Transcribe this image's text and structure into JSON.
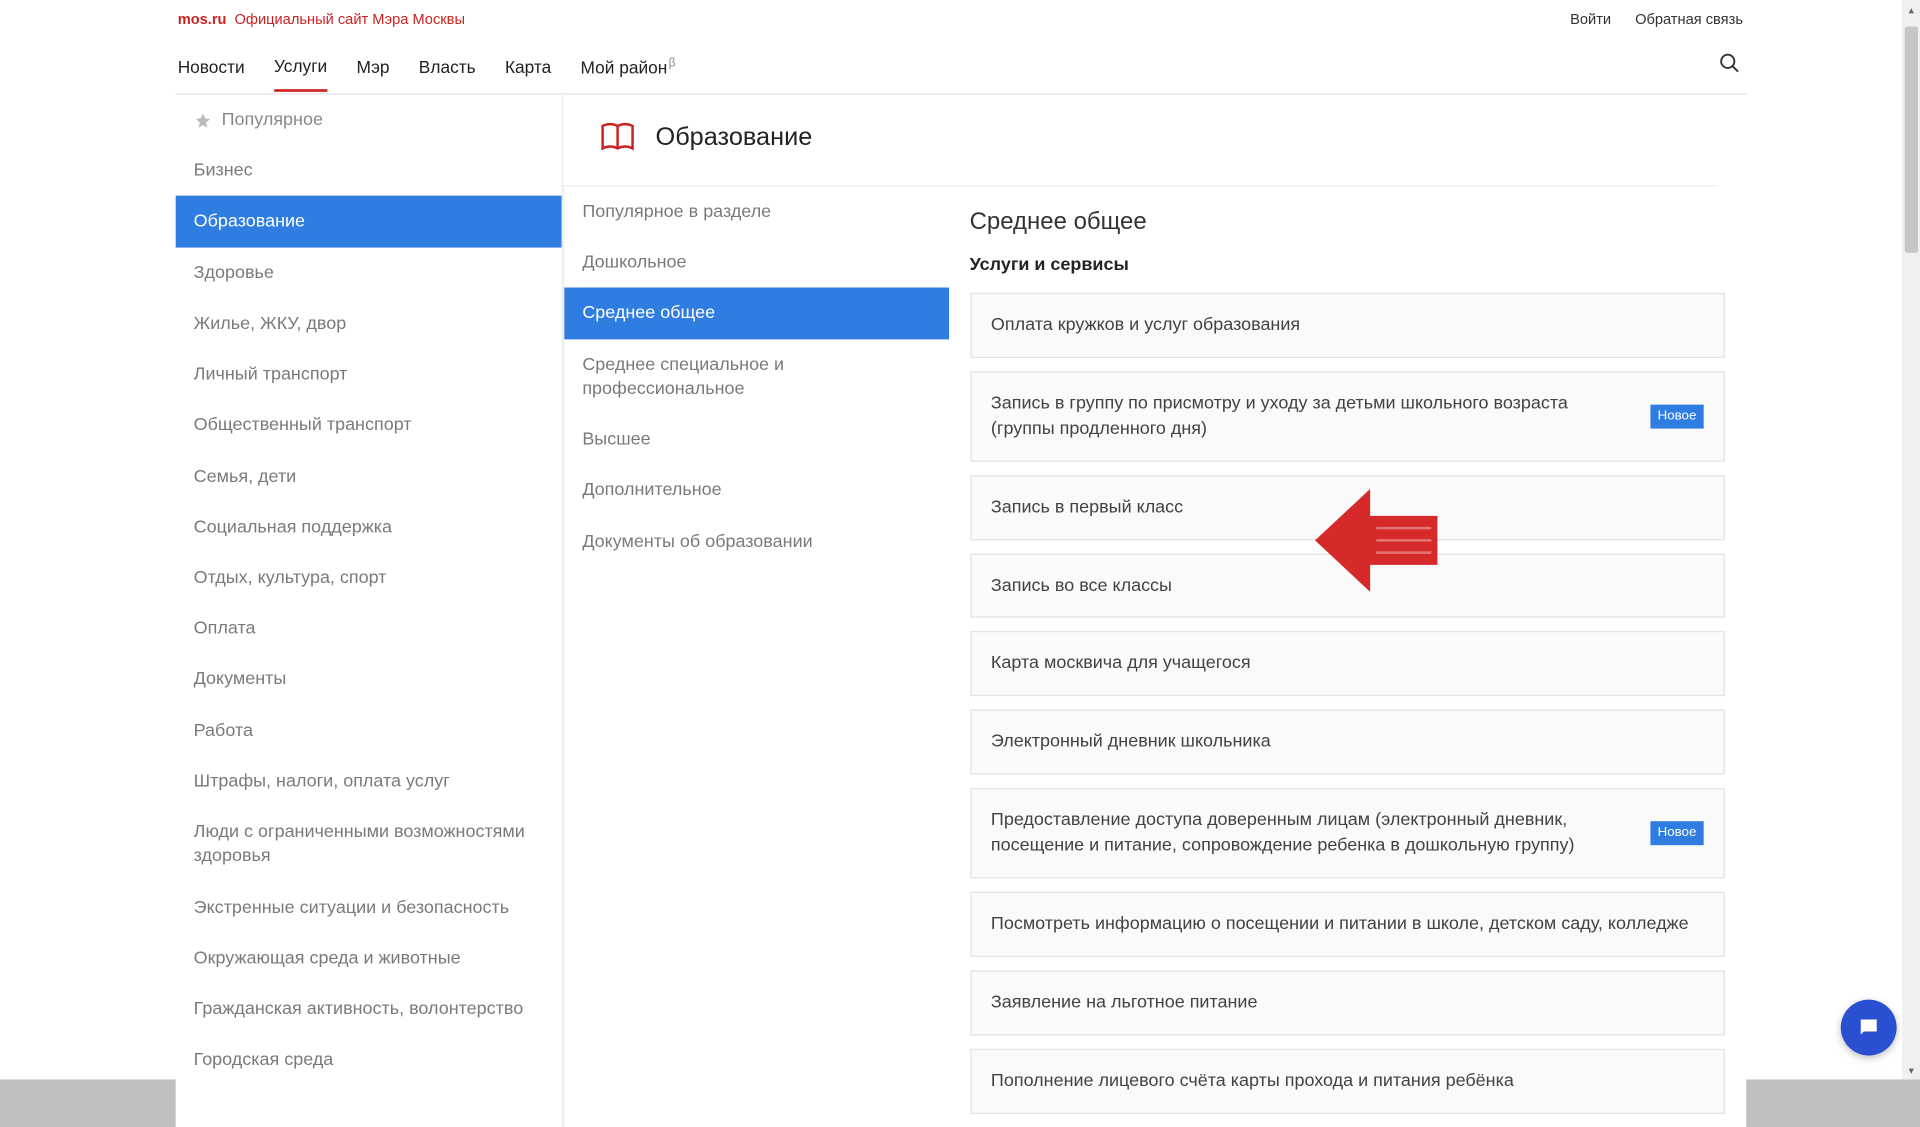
{
  "topbar": {
    "brand": "mos.ru",
    "tagline": "Официальный сайт Мэра Москвы",
    "login": "Войти",
    "feedback": "Обратная связь"
  },
  "nav": {
    "items": [
      "Новости",
      "Услуги",
      "Мэр",
      "Власть",
      "Карта",
      "Мой район"
    ],
    "active_index": 1,
    "beta_index": 5
  },
  "sidebar1": {
    "popular": "Популярное",
    "items": [
      "Бизнес",
      "Образование",
      "Здоровье",
      "Жилье, ЖКУ, двор",
      "Личный транспорт",
      "Общественный транспорт",
      "Семья, дети",
      "Социальная поддержка",
      "Отдых, культура, спорт",
      "Оплата",
      "Документы",
      "Работа",
      "Штрафы, налоги, оплата услуг",
      "Люди с ограниченными возможностями здоровья",
      "Экстренные ситуации и безопасность",
      "Окружающая среда и животные",
      "Гражданская активность, волонтерство",
      "Городская среда"
    ],
    "active_index": 1
  },
  "section": {
    "title": "Образование"
  },
  "sidebar2": {
    "items": [
      "Популярное в разделе",
      "Дошкольное",
      "Среднее общее",
      "Среднее специальное и профессиональное",
      "Высшее",
      "Дополнительное",
      "Документы об образовании"
    ],
    "active_index": 2
  },
  "main": {
    "heading": "Среднее общее",
    "subheading": "Услуги и сервисы",
    "badge_new": "Новое",
    "services": [
      {
        "label": "Оплата кружков и услуг образования",
        "new": false
      },
      {
        "label": "Запись в группу по присмотру и уходу за детьми школьного возраста (группы продленного дня)",
        "new": true
      },
      {
        "label": "Запись в первый класс",
        "new": false
      },
      {
        "label": "Запись во все классы",
        "new": false
      },
      {
        "label": "Карта москвича для учащегося",
        "new": false
      },
      {
        "label": "Электронный дневник школьника",
        "new": false
      },
      {
        "label": "Предоставление доступа доверенным лицам (электронный дневник, посещение и питание, сопровождение ребенка в дошкольную группу)",
        "new": true
      },
      {
        "label": "Посмотреть информацию о посещении и питании в школе, детском саду, колледже",
        "new": false
      },
      {
        "label": "Заявление на льготное питание",
        "new": false
      },
      {
        "label": "Пополнение лицевого счёта карты прохода и питания ребёнка",
        "new": false
      }
    ]
  }
}
